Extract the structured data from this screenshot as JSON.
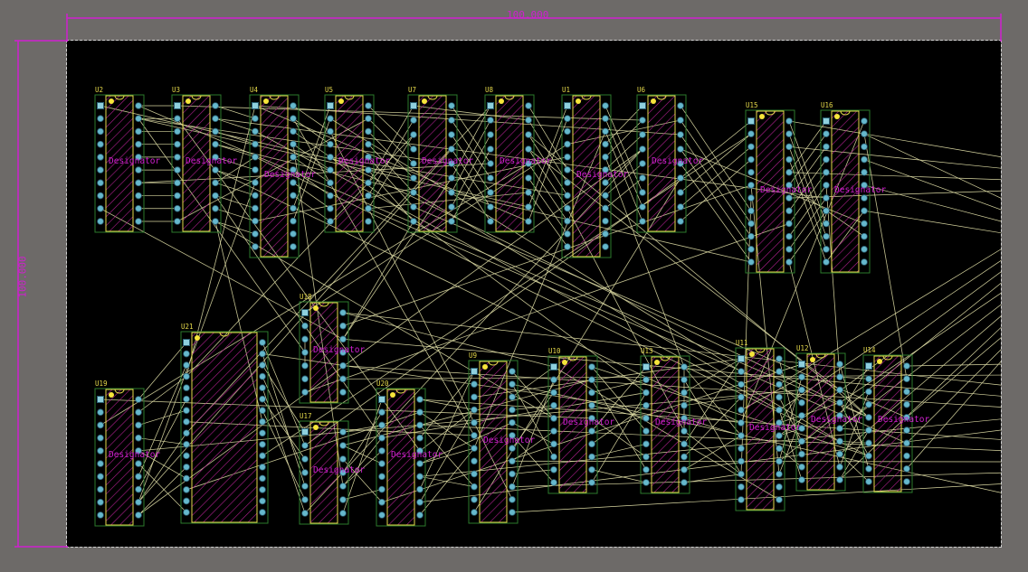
{
  "dimensions": {
    "width_label": "100.000",
    "height_label": "100.000"
  },
  "designator_text": "Designator",
  "colors": {
    "background": "#6d6a68",
    "board": "#000000",
    "outline": "#cfcfcf",
    "dimension": "#d01fd0",
    "ratsnest": "#d8d6a0",
    "footprint": "#2d7a2d",
    "body_outline": "#e5d94a",
    "hatch": "#b0208f",
    "pad": "#66b8cc",
    "ref": "#e5d94a",
    "designator": "#d01fd0",
    "pin1": "#f6e53a"
  },
  "components": [
    {
      "ref": "U2",
      "pins": 20,
      "package": "narrow"
    },
    {
      "ref": "U3",
      "pins": 20,
      "package": "narrow"
    },
    {
      "ref": "U4",
      "pins": 24,
      "package": "narrow"
    },
    {
      "ref": "U5",
      "pins": 20,
      "package": "narrow"
    },
    {
      "ref": "U7",
      "pins": 18,
      "package": "narrow"
    },
    {
      "ref": "U8",
      "pins": 18,
      "package": "narrow"
    },
    {
      "ref": "U1",
      "pins": 24,
      "package": "narrow"
    },
    {
      "ref": "U6",
      "pins": 18,
      "package": "narrow"
    },
    {
      "ref": "U15",
      "pins": 24,
      "package": "narrow"
    },
    {
      "ref": "U16",
      "pins": 24,
      "package": "narrow"
    },
    {
      "ref": "U18",
      "pins": 14,
      "package": "narrow"
    },
    {
      "ref": "U21",
      "pins": 32,
      "package": "wide"
    },
    {
      "ref": "U19",
      "pins": 20,
      "package": "narrow"
    },
    {
      "ref": "U17",
      "pins": 14,
      "package": "narrow"
    },
    {
      "ref": "U20",
      "pins": 20,
      "package": "narrow"
    },
    {
      "ref": "U9",
      "pins": 24,
      "package": "narrow"
    },
    {
      "ref": "U10",
      "pins": 20,
      "package": "narrow"
    },
    {
      "ref": "U13",
      "pins": 20,
      "package": "narrow"
    },
    {
      "ref": "U11",
      "pins": 24,
      "package": "narrow"
    },
    {
      "ref": "U12",
      "pins": 20,
      "package": "narrow"
    },
    {
      "ref": "U14",
      "pins": 20,
      "package": "narrow"
    }
  ]
}
